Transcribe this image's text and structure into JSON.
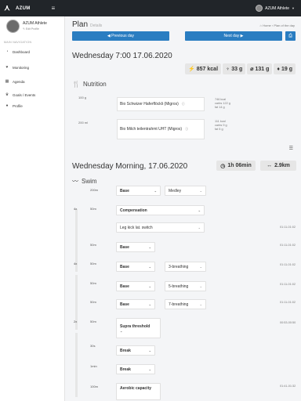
{
  "app": {
    "brand": "AZUM",
    "user_name": "AZUM Athlete"
  },
  "sidebar": {
    "profile_name": "AZUM Athlete",
    "edit_profile": "Edit Profile",
    "nav_heading": "MAIN NAVIGATION",
    "items": [
      {
        "label": "Dashboard",
        "icon": "dashboard-icon"
      },
      {
        "label": "Monitoring",
        "icon": "heart-rate-icon"
      },
      {
        "label": "Agenda",
        "icon": "calendar-icon"
      },
      {
        "label": "Goals / Events",
        "icon": "trophy-icon"
      },
      {
        "label": "Profile",
        "icon": "user-icon"
      }
    ]
  },
  "header": {
    "title": "Plan",
    "subtitle": "Details",
    "breadcrumb_home": "Home",
    "breadcrumb_page": "Plan of the day"
  },
  "toolbar": {
    "prev_label": "Previous day",
    "next_label": "Next day"
  },
  "nutrition": {
    "heading": "Wednesday 7:00 17.06.2020",
    "section": "Nutrition",
    "totals": {
      "kcal": "857 kcal",
      "carbs": "33 g",
      "protein": "131 g",
      "fat": "19 g"
    },
    "items": [
      {
        "qty": "100 g",
        "name": "Bio Schwizer Haferflöckli (Migros)",
        "kcal": "746 kcal",
        "carbs": "carbs 122 g",
        "fat": "fat 14 g"
      },
      {
        "qty": "200 ml",
        "name": "Bio Milch teilentrahmt UHT (Migros)",
        "kcal": "111 kcal",
        "carbs": "carbs 9 g",
        "fat": "fat 5 g"
      }
    ]
  },
  "workout": {
    "heading": "Wednesday Morning, 17.06.2020",
    "duration": "1h 06min",
    "distance": "2.9km",
    "sport": "Swim",
    "steps": [
      {
        "dist": "200m",
        "a": "Base",
        "b": "Medley",
        "time": ""
      },
      {
        "reps": "4x",
        "dist": "50m",
        "a": "Compensation",
        "time": ""
      },
      {
        "dist": "",
        "a": "Leg kick lat. switch",
        "time": "01:11-01:02"
      },
      {
        "dist": "50m",
        "a": "Base",
        "time": "01:11-01:02"
      },
      {
        "reps": "4x",
        "dist": "50m",
        "a": "Base",
        "b": "3-breathing",
        "time": "01:11-01:02"
      },
      {
        "dist": "50m",
        "a": "Base",
        "b": "5-breathing",
        "time": "01:11-01:02"
      },
      {
        "dist": "50m",
        "a": "Base",
        "b": "7-breathing",
        "time": "01:11-01:02"
      },
      {
        "reps": "2x",
        "dist": "50m",
        "a": "Supra threshold",
        "time": "00:53-00:50"
      },
      {
        "dist": "30s",
        "a": "Break",
        "time": ""
      },
      {
        "dist": "1min",
        "a": "Break",
        "time": ""
      },
      {
        "dist": "100m",
        "a": "Aerobic capacity",
        "time": "01:41-01:32"
      }
    ]
  }
}
